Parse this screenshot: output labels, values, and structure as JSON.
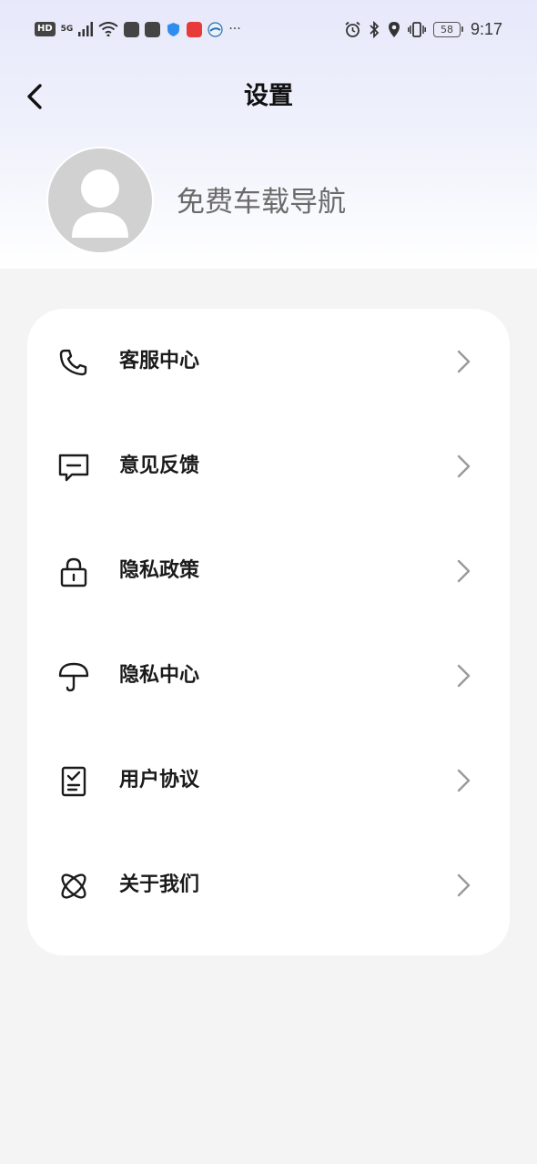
{
  "status_bar": {
    "hd_label": "HD",
    "network_label": "5G",
    "battery_level": "58",
    "time": "9:17",
    "icons": [
      "signal-icon",
      "wifi-icon",
      "alarm-icon",
      "bluetooth-icon",
      "location-icon",
      "vibrate-icon",
      "battery-icon"
    ],
    "more_label": "···"
  },
  "header": {
    "title": "设置",
    "back_icon": "chevron-left-icon"
  },
  "profile": {
    "name": "免费车载导航",
    "avatar_icon": "default-user-icon"
  },
  "menu": {
    "items": [
      {
        "label": "客服中心",
        "icon": "phone-icon"
      },
      {
        "label": "意见反馈",
        "icon": "message-icon"
      },
      {
        "label": "隐私政策",
        "icon": "lock-icon"
      },
      {
        "label": "隐私中心",
        "icon": "umbrella-icon"
      },
      {
        "label": "用户协议",
        "icon": "clipboard-check-icon"
      },
      {
        "label": "关于我们",
        "icon": "atom-icon"
      }
    ],
    "chevron_icon": "chevron-right-icon"
  },
  "colors": {
    "page_background": "#f3f4f3",
    "header_gradient_top": "#e7e9fb",
    "card_background": "#ffffff",
    "avatar_background": "#d1d1d1",
    "label_color": "#1b1b1b",
    "chevron_color": "#9a9a9a"
  }
}
